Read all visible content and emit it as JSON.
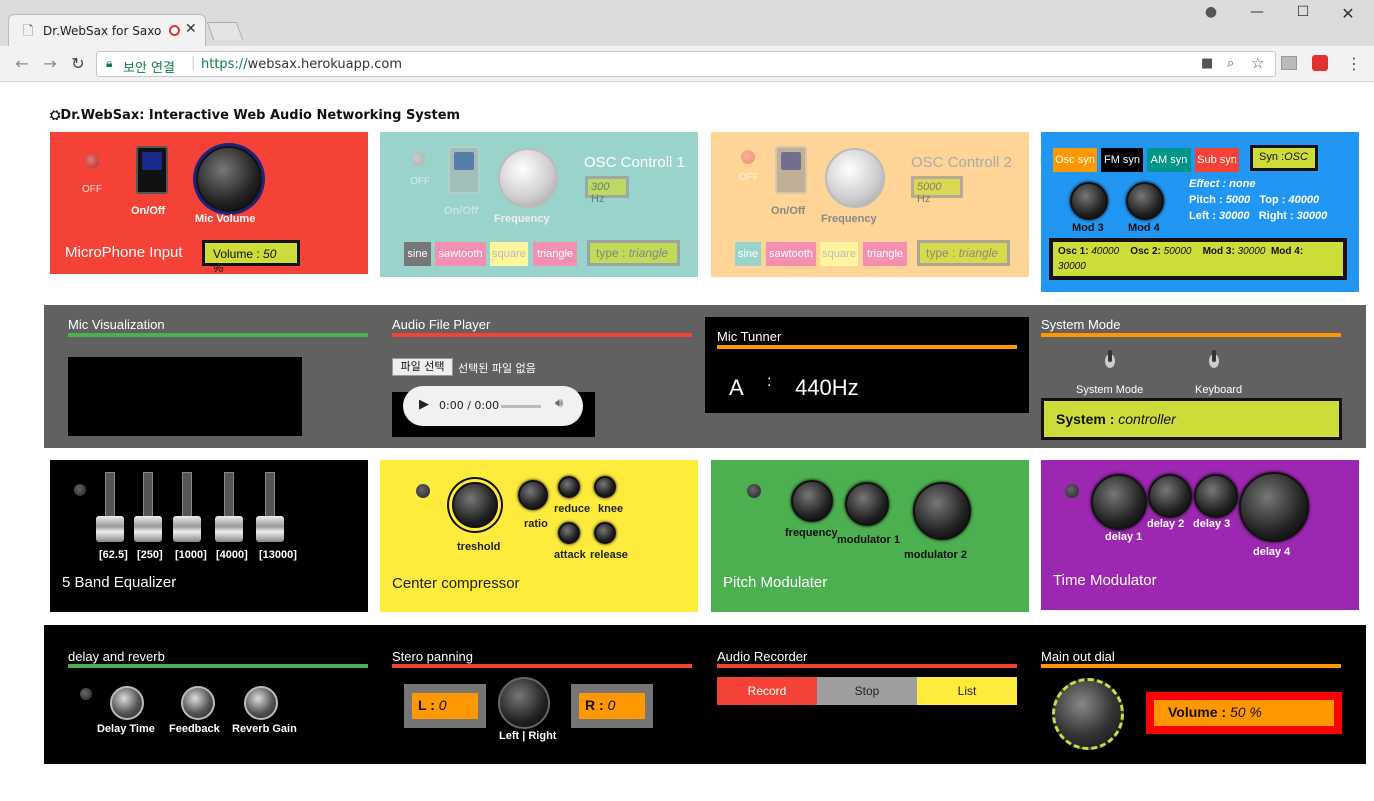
{
  "browser": {
    "tab_title": "Dr.WebSax for Saxop",
    "security_label": "보안 연결",
    "url_scheme": "https://",
    "url_host": "websax.herokuapp.com"
  },
  "page": {
    "title": "Dr.WebSax: Interactive Web Audio Networking System"
  },
  "mic": {
    "off_label": "OFF",
    "onoff_label": "On/Off",
    "volume_knob_label": "Mic Volume",
    "title": "MicroPhone Input",
    "volume_label": "Volume :",
    "volume_value": "50 %"
  },
  "osc1": {
    "off_label": "OFF",
    "onoff_label": "On/Off",
    "freq_label": "Frequency",
    "title": "OSC Controll 1",
    "freq_value": "300",
    "freq_unit": "Hz",
    "waves": [
      "sine",
      "sawtooth",
      "square",
      "triangle"
    ],
    "type_label": "type :",
    "type_value": "triangle"
  },
  "osc2": {
    "off_label": "OFF",
    "onoff_label": "On/Off",
    "freq_label": "Frequency",
    "title": "OSC Controll 2",
    "freq_value": "5000",
    "freq_unit": "Hz",
    "waves": [
      "sine",
      "sawtooth",
      "square",
      "triangle"
    ],
    "type_label": "type :",
    "type_value": "triangle"
  },
  "syn": {
    "buttons": [
      "Osc syn",
      "FM syn",
      "AM syn",
      "Sub syn"
    ],
    "syn_label": "Syn :",
    "syn_value": "OSC",
    "effect_label": "Effect :",
    "effect_value": "none",
    "pitch_label": "Pitch :",
    "pitch_value": "5000",
    "top_label": "Top :",
    "top_value": "40000",
    "left_label": "Left :",
    "left_value": "30000",
    "right_label": "Right :",
    "right_value": "30000",
    "mod3_label": "Mod 3",
    "mod4_label": "Mod 4",
    "osc1_label": "Osc 1:",
    "osc1_value": "40000",
    "osc2_label": "Osc 2:",
    "osc2_value": "50000",
    "mod3_value_label": "Mod 3:",
    "mod3_value": "30000",
    "mod4_value_label": "Mod 4:",
    "mod4_value": "30000"
  },
  "viz": {
    "title": "Mic Visualization"
  },
  "player": {
    "title": "Audio File Player",
    "choose_btn": "파일 선택",
    "no_file": "선택된 파일 없음",
    "time": "0:00 / 0:00"
  },
  "tuner": {
    "title": "Mic Tunner",
    "note": "A",
    "sep": ":",
    "freq": "440Hz"
  },
  "system": {
    "title": "System Mode",
    "mode_label": "System Mode",
    "keyboard_label": "Keyboard",
    "status_label": "System :",
    "status_value": "controller"
  },
  "eq": {
    "bands": [
      "[62.5]",
      "[250]",
      "[1000]",
      "[4000]",
      "[13000]"
    ],
    "title": "5 Band Equalizer"
  },
  "comp": {
    "treshold": "treshold",
    "ratio": "ratio",
    "reduce": "reduce",
    "knee": "knee",
    "attack": "attack",
    "release": "release",
    "title": "Center compressor"
  },
  "pitchmod": {
    "frequency": "frequency",
    "mod1": "modulator 1",
    "mod2": "modulator 2",
    "title": "Pitch Modulater"
  },
  "timemod": {
    "delay1": "delay 1",
    "delay2": "delay 2",
    "delay3": "delay 3",
    "delay4": "delay 4",
    "title": "Time Modulator"
  },
  "delay": {
    "title": "delay and reverb",
    "delay_time": "Delay Time",
    "feedback": "Feedback",
    "reverb_gain": "Reverb Gain"
  },
  "pan": {
    "title": "Stero panning",
    "l_label": "L :",
    "l_value": "0",
    "r_label": "R :",
    "r_value": "0",
    "knob_label": "Left | Right"
  },
  "recorder": {
    "title": "Audio Recorder",
    "record": "Record",
    "stop": "Stop",
    "list": "List"
  },
  "mainout": {
    "title": "Main out dial",
    "volume_label": "Volume :",
    "volume_value": "50 %"
  },
  "colors": {
    "red": "#f44336",
    "teal": "#9ad3cc",
    "peach": "#fed596",
    "blue": "#2196f3",
    "gray": "#616161",
    "yellow": "#ffeb3b",
    "green": "#4caf50",
    "purple": "#9c27b0",
    "lime": "#cddc39",
    "orange": "#ff9800"
  }
}
